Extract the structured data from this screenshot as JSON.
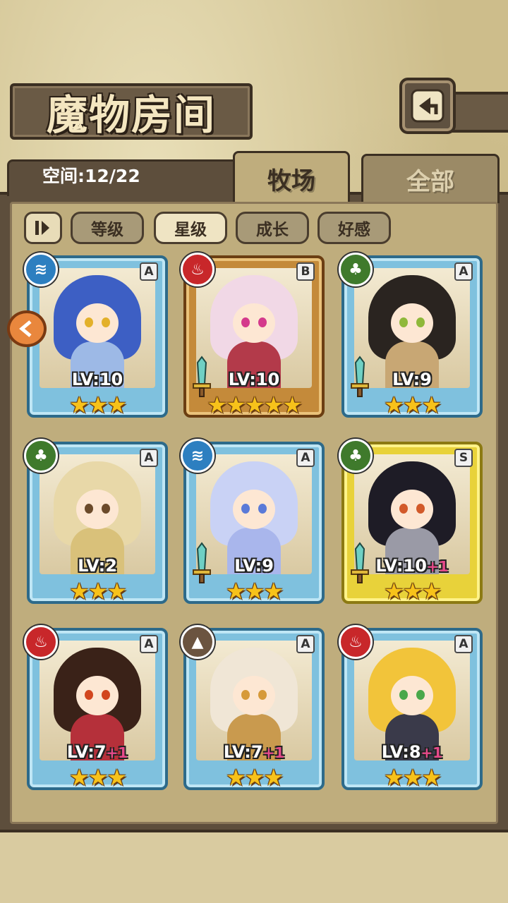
{
  "header": {
    "title": "魔物房间",
    "back_icon": "back-arrow-icon"
  },
  "space": {
    "label": "空间:12/22"
  },
  "tabs": [
    {
      "label": "牧场",
      "active": true
    },
    {
      "label": "全部",
      "active": false
    }
  ],
  "sort": {
    "toggle_icon": "sort-order-icon",
    "buttons": [
      {
        "label": "等级",
        "active": false
      },
      {
        "label": "星级",
        "active": true
      },
      {
        "label": "成长",
        "active": false
      },
      {
        "label": "好感",
        "active": false
      }
    ]
  },
  "monsters": [
    {
      "element": "water",
      "rank": "A",
      "level": "LV:10",
      "plus": "",
      "stars": 3,
      "frame": "blue",
      "hair": "#3d5fc4",
      "eye": "#e3b02a",
      "body": "#9db9e6",
      "sword": false
    },
    {
      "element": "fire",
      "rank": "B",
      "level": "LV:10",
      "plus": "",
      "stars": 5,
      "frame": "gold",
      "hair": "#f1d8e6",
      "eye": "#d43a8c",
      "body": "#b33a4a",
      "sword": true
    },
    {
      "element": "wood",
      "rank": "A",
      "level": "LV:9",
      "plus": "",
      "stars": 3,
      "frame": "blue",
      "hair": "#2a2420",
      "eye": "#8fb83a",
      "body": "#c8a774",
      "sword": true
    },
    {
      "element": "wood",
      "rank": "A",
      "level": "LV:2",
      "plus": "",
      "stars": 3,
      "frame": "blue",
      "hair": "#e8d8a8",
      "eye": "#6b4a2a",
      "body": "#d9c17a",
      "sword": false
    },
    {
      "element": "water",
      "rank": "A",
      "level": "LV:9",
      "plus": "",
      "stars": 3,
      "frame": "blue",
      "hair": "#c9d2f5",
      "eye": "#5a7ad8",
      "body": "#a9b6ec",
      "sword": true
    },
    {
      "element": "wood",
      "rank": "S",
      "level": "LV:10",
      "plus": "+1",
      "stars": 3,
      "frame": "yellow",
      "hair": "#1e1c26",
      "eye": "#d25a2a",
      "body": "#9a9aa6",
      "sword": true
    },
    {
      "element": "fire",
      "rank": "A",
      "level": "LV:7",
      "plus": "+1",
      "stars": 3,
      "frame": "blue",
      "hair": "#3a2218",
      "eye": "#d2461e",
      "body": "#b5303a",
      "sword": false
    },
    {
      "element": "earth",
      "rank": "A",
      "level": "LV:7",
      "plus": "+1",
      "stars": 3,
      "frame": "blue",
      "hair": "#f0e6d6",
      "eye": "#d69a3a",
      "body": "#c99a4e",
      "sword": false
    },
    {
      "element": "fire",
      "rank": "A",
      "level": "LV:8",
      "plus": "+1",
      "stars": 3,
      "frame": "blue",
      "hair": "#f2c43a",
      "eye": "#4aa84a",
      "body": "#3a3a4a",
      "sword": false
    }
  ],
  "side_button_icon": "scroll-left-icon",
  "colors": {
    "water": "#2d7fc0",
    "fire": "#c8272a",
    "wood": "#3f7a2c",
    "earth": "#6b5440",
    "star": "#f7c21a",
    "plus": "#e64a8a"
  }
}
